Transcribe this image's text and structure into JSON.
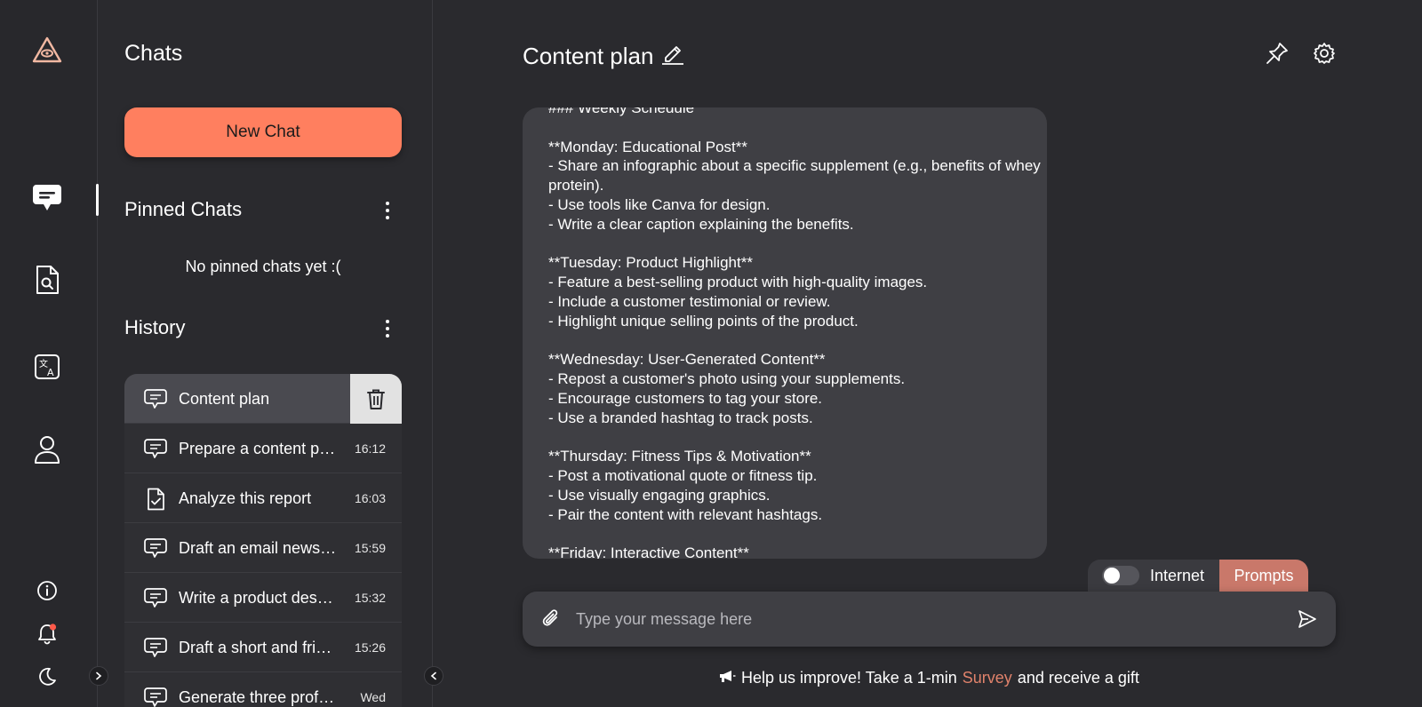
{
  "rail": {
    "logo_icon": "triangle-eye-logo",
    "items": [
      {
        "icon": "chat-bubble-icon",
        "active": true
      },
      {
        "icon": "document-search-icon"
      },
      {
        "icon": "translate-icon"
      },
      {
        "icon": "user-icon"
      }
    ],
    "bottom": [
      {
        "icon": "info-icon"
      },
      {
        "icon": "bell-icon",
        "badge_color": "#ff5a4a"
      },
      {
        "icon": "moon-icon"
      }
    ]
  },
  "panel": {
    "title": "Chats",
    "new_chat_label": "New Chat",
    "pinned_title": "Pinned Chats",
    "pinned_empty": "No pinned chats yet :(",
    "history_title": "History",
    "history": [
      {
        "icon": "chat-icon",
        "title": "Content plan",
        "time": ""
      },
      {
        "icon": "chat-icon",
        "title": "Prepare a content plan",
        "time": "16:12"
      },
      {
        "icon": "document-check-icon",
        "title": "Analyze this report",
        "time": "16:03"
      },
      {
        "icon": "chat-icon",
        "title": "Draft an email newsletter",
        "time": "15:59"
      },
      {
        "icon": "chat-icon",
        "title": "Write a product description",
        "time": "15:32"
      },
      {
        "icon": "chat-icon",
        "title": "Draft a short and friendly",
        "time": "15:26"
      },
      {
        "icon": "chat-icon",
        "title": "Generate three professional",
        "time": "Wed"
      }
    ]
  },
  "main": {
    "title": "Content plan",
    "message": "### Weekly Schedule\n\n**Monday: Educational Post**\n- Share an infographic about a specific supplement (e.g., benefits of whey protein).\n- Use tools like Canva for design.\n- Write a clear caption explaining the benefits.\n\n**Tuesday: Product Highlight**\n- Feature a best-selling product with high-quality images.\n- Include a customer testimonial or review.\n- Highlight unique selling points of the product.\n\n**Wednesday: User-Generated Content**\n- Repost a customer's photo using your supplements.\n- Encourage customers to tag your store.\n- Use a branded hashtag to track posts.\n\n**Thursday: Fitness Tips & Motivation**\n- Post a motivational quote or fitness tip.\n- Use visually engaging graphics.\n- Pair the content with relevant hashtags.\n\n**Friday: Interactive Content**",
    "internet_label": "Internet",
    "internet_on": false,
    "prompts_label": "Prompts",
    "input_placeholder": "Type your message here",
    "survey_pre": "Help us improve! Take a 1-min",
    "survey_link": "Survey",
    "survey_post": "and receive a gift"
  },
  "colors": {
    "accent": "#ff7f5f",
    "prompts": "#c9786a",
    "link": "#e0826b",
    "background": "#2a2a2e"
  }
}
